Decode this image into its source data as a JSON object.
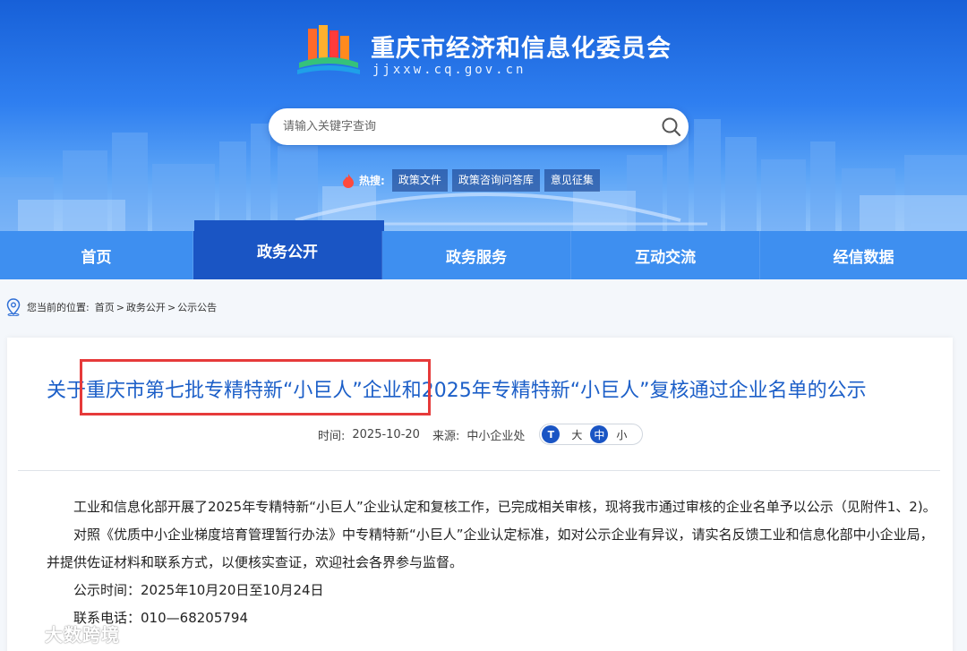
{
  "header": {
    "site_title": "重庆市经济和信息化委员会",
    "site_domain": "jjxxw.cq.gov.cn"
  },
  "search": {
    "placeholder": "请输入关键字查询"
  },
  "hot_search": {
    "label": "热搜:",
    "tags": [
      "政策文件",
      "政策咨询问答库",
      "意见征集"
    ]
  },
  "nav": {
    "items": [
      "首页",
      "政务公开",
      "政务服务",
      "互动交流",
      "经信数据"
    ],
    "active": "政务公开"
  },
  "breadcrumb": {
    "prefix": "您当前的位置:",
    "items": [
      "首页",
      "政务公开",
      "公示公告"
    ],
    "separator": ">"
  },
  "article": {
    "title": "关于重庆市第七批专精特新“小巨人”企业和2025年专精特新“小巨人”复核通过企业名单的公示",
    "time_label": "时间:",
    "time_value": "2025-10-20",
    "source_label": "来源:",
    "source_value": "中小企业处",
    "font_size": {
      "large": "大",
      "medium": "中",
      "small": "小",
      "selected": "中"
    },
    "paragraphs": [
      "工业和信息化部开展了2025年专精特新“小巨人”企业认定和复核工作，已完成相关审核，现将我市通过审核的企业名单予以公示（见附件1、2)。",
      "对照《优质中小企业梯度培育管理暂行办法》中专精特新“小巨人”企业认定标准，如对公示企业有异议，请实名反馈工业和信息化部中小企业局，并提供佐证材料和联系方式，以便核实查证，欢迎社会各界参与监督。",
      "公示时间：2025年10月20日至10月24日",
      "联系电话：010—68205794"
    ]
  },
  "watermark": {
    "text": "大数跨境"
  },
  "colors": {
    "banner_top": "#1760d8",
    "nav_bg": "#3e8ff0",
    "nav_active": "#1a55c4",
    "title_blue": "#1c5fc8",
    "highlight_red": "#e63a3a"
  }
}
